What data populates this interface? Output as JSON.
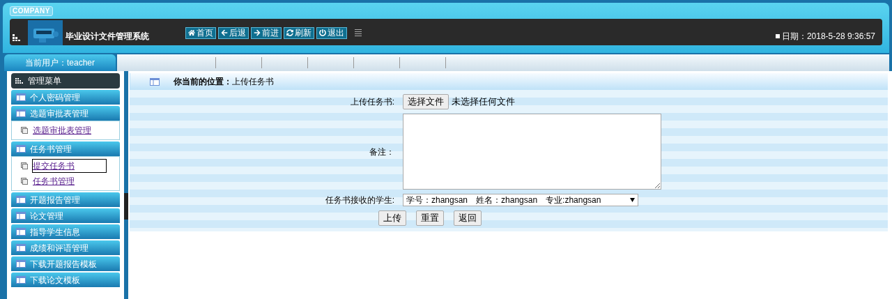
{
  "header": {
    "company": "COMPANY",
    "title": "毕业设计文件管理系统",
    "nav": [
      "首页",
      "后退",
      "前进",
      "刷新",
      "退出"
    ],
    "date": "日期：2018-5-28 9:36:57"
  },
  "user": "当前用户：teacher",
  "sidebar": {
    "title": "管理菜单",
    "groups": [
      {
        "label": "个人密码管理"
      },
      {
        "label": "选题审批表管理",
        "children": [
          {
            "label": "选题审批表管理",
            "selected": false
          }
        ]
      },
      {
        "label": "任务书管理",
        "children": [
          {
            "label": "提交任务书",
            "selected": true
          },
          {
            "label": "任务书管理",
            "selected": false
          }
        ]
      },
      {
        "label": "开题报告管理"
      },
      {
        "label": "论文管理"
      },
      {
        "label": "指导学生信息"
      },
      {
        "label": "成绩和评语管理"
      },
      {
        "label": "下载开题报告模板"
      },
      {
        "label": "下载论文模板"
      }
    ]
  },
  "breadcrumb": {
    "label": "你当前的位置：",
    "value": "上传任务书"
  },
  "form": {
    "file": {
      "label": "上传任务书:",
      "button": "选择文件",
      "status": "未选择任何文件"
    },
    "remark": {
      "label": "备注："
    },
    "student": {
      "label": "任务书接收的学生:",
      "value": "学号：zhangsan　姓名：zhangsan　专业:zhangsan"
    },
    "buttons": [
      "上传",
      "重置",
      "返回"
    ]
  }
}
